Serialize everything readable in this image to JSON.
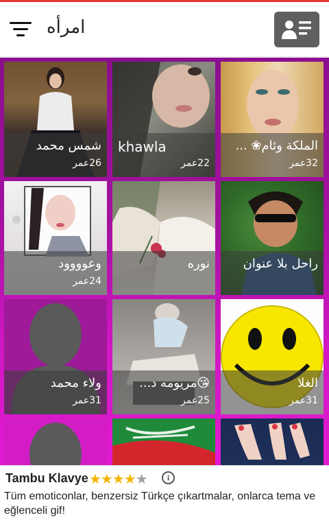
{
  "header": {
    "title": "امرأه",
    "menu_icon": "filter-menu-icon",
    "profile_icon": "contact-card-icon"
  },
  "colors": {
    "accent_top": "#e53935",
    "grid_background_top": "#8b0f8f",
    "grid_background_bottom": "#e21ad2",
    "caption_overlay": "rgba(60,60,60,0.55)",
    "star": "#f4b400"
  },
  "profiles": [
    {
      "name": "شمس محمد",
      "age": "26عمر"
    },
    {
      "name": "khawla",
      "age": "22عمر"
    },
    {
      "name": "الملكة وئام❀ ...",
      "age": "32عمر"
    },
    {
      "name": "وعوووود",
      "age": "24عمر"
    },
    {
      "name": "نوره",
      "age": ""
    },
    {
      "name": "راحل بلا عنوان",
      "age": ""
    },
    {
      "name": "ولاء محمد",
      "age": "31عمر"
    },
    {
      "name": "😘مريومه د...",
      "age": "25عمر"
    },
    {
      "name": "الغلا",
      "age": "31عمر"
    }
  ],
  "ad": {
    "title": "Tambu Klavye",
    "rating": 4.5,
    "stars_full": "★★★★",
    "stars_half": "★",
    "info_icon": "i",
    "body": "Tüm emoticonlar, benzersiz Türkçe çıkartmalar, onlarca tema ve eğlenceli gif!"
  }
}
